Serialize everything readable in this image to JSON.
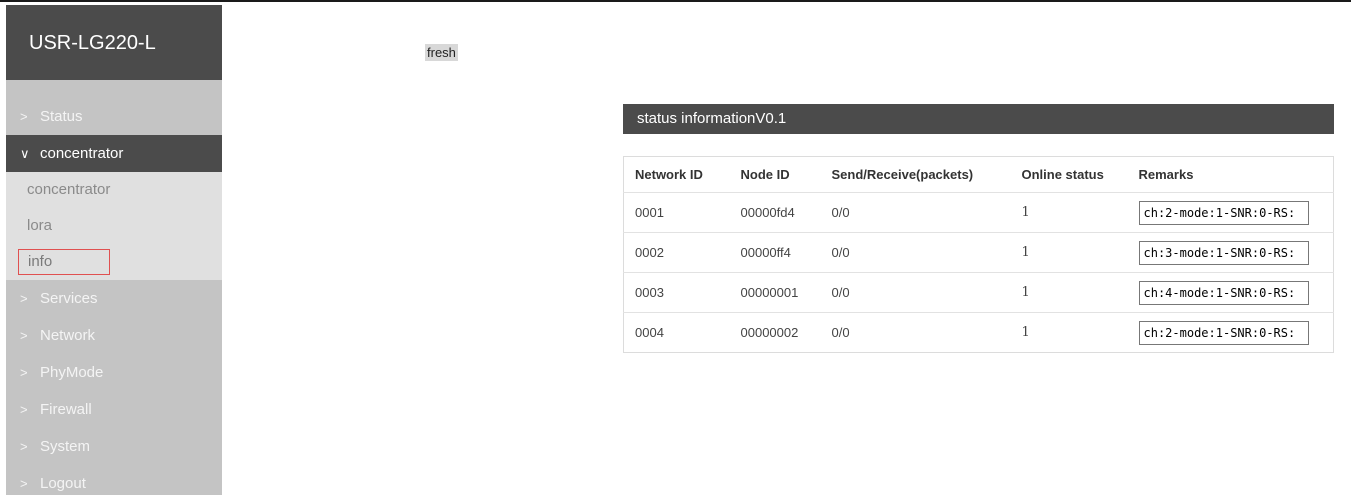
{
  "brand": "USR-LG220-L",
  "nav": {
    "status": "Status",
    "concentrator": "concentrator",
    "sub": [
      "concentrator",
      "lora",
      "info"
    ],
    "services": "Services",
    "network": "Network",
    "phymode": "PhyMode",
    "firewall": "Firewall",
    "system": "System",
    "logout": "Logout"
  },
  "fresh_label": "fresh",
  "panel_title": "status informationV0.1",
  "table": {
    "headers": [
      "Network ID",
      "Node ID",
      "Send/Receive(packets)",
      "Online status",
      "Remarks"
    ],
    "rows": [
      {
        "network_id": "0001",
        "node_id": "00000fd4",
        "send_receive": "0/0",
        "online": "1",
        "remarks": "ch:2-mode:1-SNR:0-RS:"
      },
      {
        "network_id": "0002",
        "node_id": "00000ff4",
        "send_receive": "0/0",
        "online": "1",
        "remarks": "ch:3-mode:1-SNR:0-RS:"
      },
      {
        "network_id": "0003",
        "node_id": "00000001",
        "send_receive": "0/0",
        "online": "1",
        "remarks": "ch:4-mode:1-SNR:0-RS:"
      },
      {
        "network_id": "0004",
        "node_id": "00000002",
        "send_receive": "0/0",
        "online": "1",
        "remarks": "ch:2-mode:1-SNR:0-RS:"
      }
    ]
  },
  "colors": {
    "sidebar_bg": "#c4c4c4",
    "header_dark": "#4b4b4b",
    "submenu_bg": "#e0e0e0",
    "current_outline": "#e05050"
  }
}
